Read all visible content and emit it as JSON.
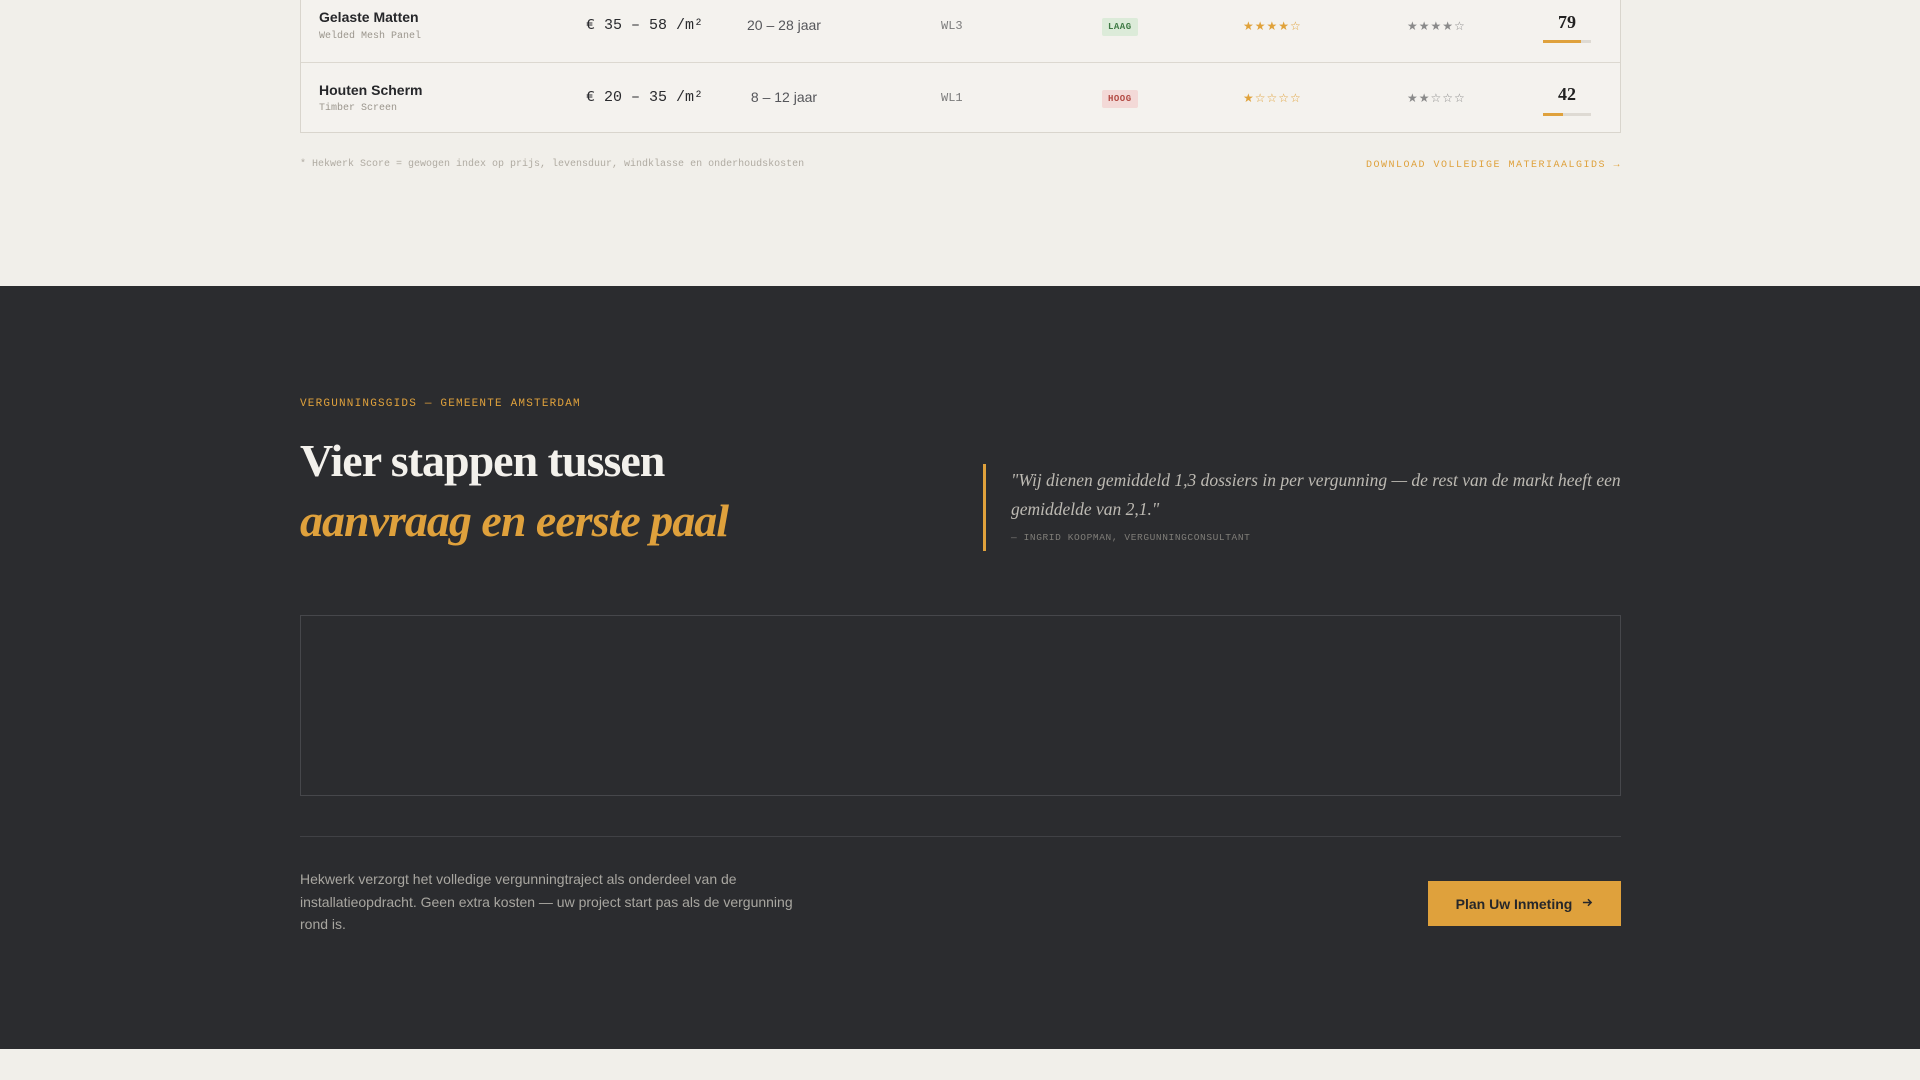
{
  "materials_table": {
    "rows": [
      {
        "name": "Gelaste Matten",
        "subtitle": "Welded Mesh Panel",
        "price": "€ 35 – 58 /m²",
        "lifespan": "20 – 28 jaar",
        "wind_class": "WL3",
        "maintenance": "LAAG",
        "maintenance_level": "low",
        "rating_a": "★★★★☆",
        "rating_b": "★★★★☆",
        "score": "79",
        "score_value": 79
      },
      {
        "name": "Houten Scherm",
        "subtitle": "Timber Screen",
        "price": "€ 20 – 35 /m²",
        "lifespan": "8 – 12 jaar",
        "wind_class": "WL1",
        "maintenance": "HOOG",
        "maintenance_level": "high",
        "rating_a": "★☆☆☆☆",
        "rating_b": "★★☆☆☆",
        "score": "42",
        "score_value": 42
      }
    ],
    "footnote": "* Hekwerk Score = gewogen index op prijs, levensduur, windklasse en onderhoudskosten",
    "download_link": "DOWNLOAD VOLLEDIGE MATERIAALGIDS →"
  },
  "permit_section": {
    "eyebrow": "VERGUNNINGSGIDS — GEMEENTE AMSTERDAM",
    "heading_line1": "Vier stappen tussen",
    "heading_line2": "aanvraag en eerste paal",
    "quote": "\"Wij dienen gemiddeld 1,3 dossiers in per vergunning — de rest van de markt heeft een gemiddelde van 2,1.\"",
    "quote_cite": "— INGRID KOOPMAN, VERGUNNINGCONSULTANT",
    "body_text": "Hekwerk verzorgt het volledige vergunningtraject als onderdeel van de installatieopdracht. Geen extra kosten — uw project start pas als de vergunning rond is.",
    "cta_label": "Plan Uw Inmeting",
    "cta_icon": "arrow-right-icon"
  },
  "colors": {
    "accent": "#dfa13c",
    "dark_bg": "#2b2c2f",
    "light_bg": "#f1efea",
    "badge_low_bg": "#dcebd9",
    "badge_high_bg": "#f3d9d7"
  }
}
